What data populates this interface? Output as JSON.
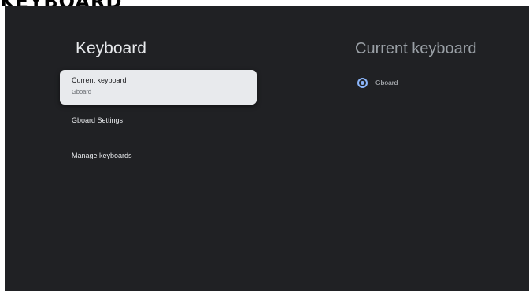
{
  "caption": "KEYBOARD",
  "left_panel": {
    "title": "Keyboard",
    "items": [
      {
        "label": "Current keyboard",
        "subtitle": "Gboard",
        "focused": true
      },
      {
        "label": "Gboard Settings"
      },
      {
        "label": "Manage keyboards"
      }
    ]
  },
  "right_panel": {
    "title": "Current keyboard",
    "options": [
      {
        "label": "Gboard",
        "selected": true
      }
    ]
  },
  "colors": {
    "background": "#202124",
    "focused_item": "#e8eaed",
    "accent": "#8ab4f8"
  }
}
